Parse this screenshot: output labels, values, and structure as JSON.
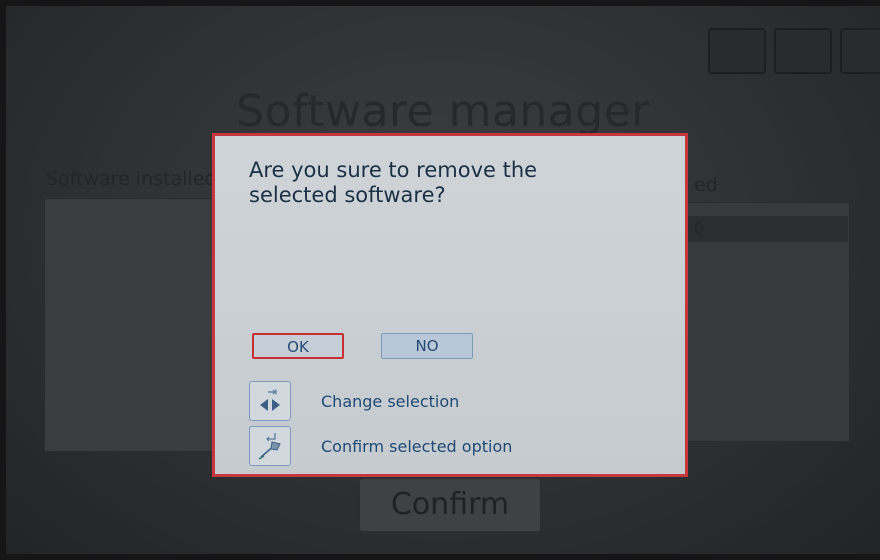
{
  "background": {
    "title": "Software manager",
    "left_panel_label": "Software installed",
    "right_panel_label": "ed",
    "right_panel_row": "0",
    "confirm_button": "Confirm"
  },
  "dialog": {
    "message": "Are you sure to remove the\nselected software?",
    "ok_label": "OK",
    "no_label": "NO",
    "hints": [
      {
        "icon": "tab-arrows-icon",
        "label": "Change selection"
      },
      {
        "icon": "enter-pen-icon",
        "label": "Confirm selected option"
      }
    ]
  },
  "colors": {
    "dialog_border": "#c4373d",
    "dialog_background": "#cfd4d8",
    "message_text": "#1b3044",
    "hint_text": "#214a75",
    "selected_outline": "#c82f34"
  }
}
